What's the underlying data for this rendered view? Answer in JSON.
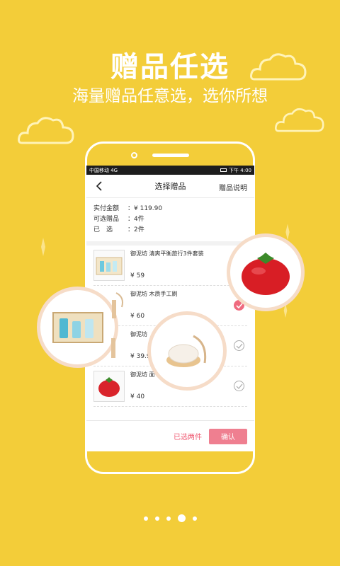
{
  "hero": {
    "title": "赠品任选",
    "subtitle": "海量赠品任意选，选你所想"
  },
  "status": {
    "carrier": "中国移动 4G",
    "time": "下午 4:00"
  },
  "nav": {
    "title": "选择赠品",
    "explain": "赠品说明"
  },
  "summary": [
    {
      "label": "实付金额",
      "value": "：¥ 119.90"
    },
    {
      "label": "可选赠品",
      "value": "：4件"
    },
    {
      "label": "已　选",
      "value": "：2件"
    }
  ],
  "items": [
    {
      "name": "御泥坊  清爽平衡旅行3件套装",
      "price": "¥ 59",
      "checked": false
    },
    {
      "name": "御泥坊  木质手工刷",
      "price": "¥ 60",
      "checked": true
    },
    {
      "name": "御泥坊",
      "price": "¥ 39.9",
      "checked": false
    },
    {
      "name": "御泥坊  面",
      "price": "¥ 40",
      "checked": false
    }
  ],
  "footer": {
    "selected": "已选两件",
    "confirm": "确认"
  },
  "pager": {
    "count": 5,
    "active": 3
  },
  "colors": {
    "background": "#f3cd39",
    "accent": "#ef7f90",
    "check": "#ef6b7f"
  }
}
